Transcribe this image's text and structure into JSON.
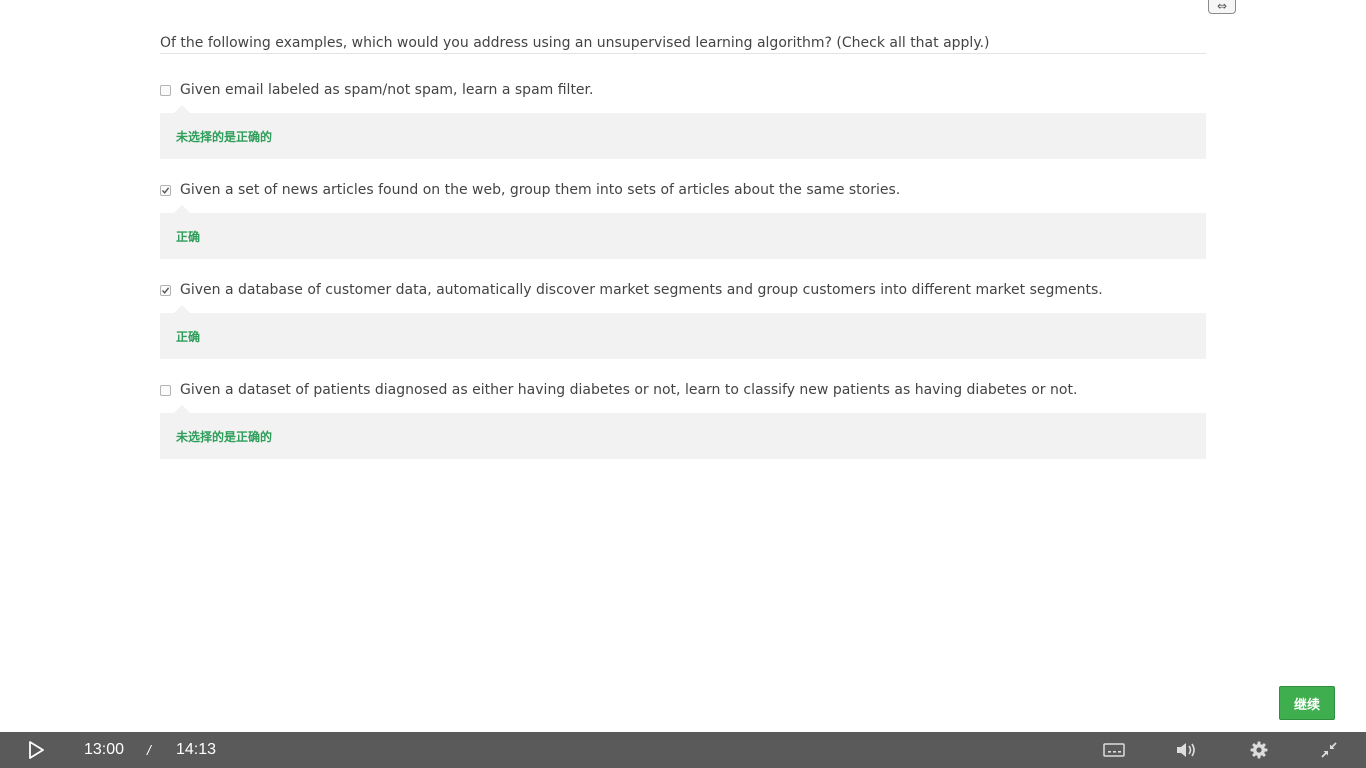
{
  "question": {
    "text": "Of the following examples, which would you address using an unsupervised learning algorithm? (Check all that apply.)"
  },
  "options": [
    {
      "label": "Given email labeled as spam/not spam, learn a spam filter.",
      "checked": false,
      "feedback": "未选择的是正确的"
    },
    {
      "label": "Given a set of news articles found on the web, group them into sets of articles about the same stories.",
      "checked": true,
      "feedback": "正确"
    },
    {
      "label": "Given a database of customer data, automatically discover market segments and group customers into different market segments.",
      "checked": true,
      "feedback": "正确"
    },
    {
      "label": "Given a dataset of patients diagnosed as either having diabetes or not, learn to classify new patients as having diabetes or not.",
      "checked": false,
      "feedback": "未选择的是正确的"
    }
  ],
  "continue_label": "继续",
  "player": {
    "current_time": "13:00",
    "separator": "/",
    "duration": "14:13",
    "icons": {
      "play": "play-icon",
      "captions": "captions-icon",
      "volume": "volume-icon",
      "settings": "gear-icon",
      "exit_fullscreen": "exit-fullscreen-icon"
    }
  },
  "colors": {
    "feedback_text": "#2e9e5b",
    "feedback_bg": "#f2f2f2",
    "continue_bg": "#3fae4e",
    "control_bar_bg": "#5a5a5a"
  }
}
